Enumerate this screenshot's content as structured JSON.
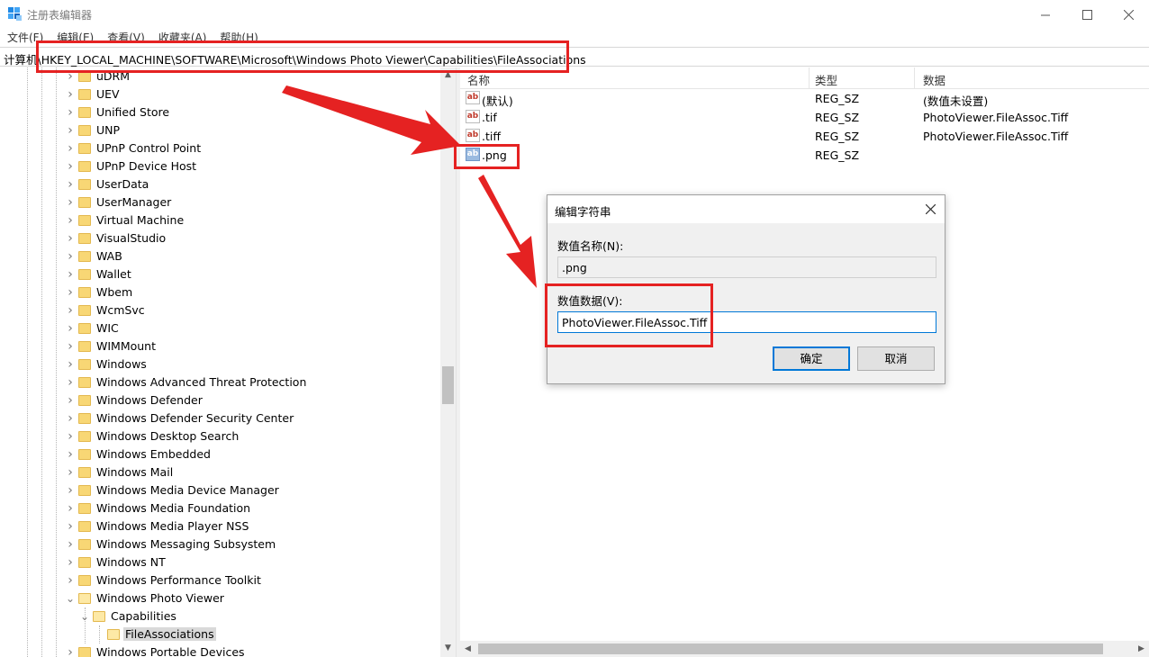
{
  "window": {
    "title": "注册表编辑器",
    "minimize_icon": "minimize-icon",
    "maximize_icon": "maximize-icon",
    "close_icon": "close-icon"
  },
  "menu": [
    "文件(F)",
    "编辑(E)",
    "查看(V)",
    "收藏夹(A)",
    "帮助(H)"
  ],
  "address": "计算机\\HKEY_LOCAL_MACHINE\\SOFTWARE\\Microsoft\\Windows Photo Viewer\\Capabilities\\FileAssociations",
  "tree": {
    "items": [
      {
        "label": "uDRM"
      },
      {
        "label": "UEV"
      },
      {
        "label": "Unified Store"
      },
      {
        "label": "UNP"
      },
      {
        "label": "UPnP Control Point"
      },
      {
        "label": "UPnP Device Host"
      },
      {
        "label": "UserData"
      },
      {
        "label": "UserManager"
      },
      {
        "label": "Virtual Machine"
      },
      {
        "label": "VisualStudio"
      },
      {
        "label": "WAB"
      },
      {
        "label": "Wallet"
      },
      {
        "label": "Wbem"
      },
      {
        "label": "WcmSvc"
      },
      {
        "label": "WIC"
      },
      {
        "label": "WIMMount"
      },
      {
        "label": "Windows"
      },
      {
        "label": "Windows Advanced Threat Protection"
      },
      {
        "label": "Windows Defender"
      },
      {
        "label": "Windows Defender Security Center"
      },
      {
        "label": "Windows Desktop Search"
      },
      {
        "label": "Windows Embedded"
      },
      {
        "label": "Windows Mail"
      },
      {
        "label": "Windows Media Device Manager"
      },
      {
        "label": "Windows Media Foundation"
      },
      {
        "label": "Windows Media Player NSS"
      },
      {
        "label": "Windows Messaging Subsystem"
      },
      {
        "label": "Windows NT"
      },
      {
        "label": "Windows Performance Toolkit"
      },
      {
        "label": "Windows Photo Viewer",
        "expanded": true
      },
      {
        "label": "Capabilities",
        "expanded": true
      },
      {
        "label": "FileAssociations",
        "selected": true
      },
      {
        "label": "Windows Portable Devices"
      }
    ]
  },
  "list": {
    "columns": [
      "名称",
      "类型",
      "数据"
    ],
    "rows": [
      {
        "name": "(默认)",
        "type": "REG_SZ",
        "data": "(数值未设置)"
      },
      {
        "name": ".tif",
        "type": "REG_SZ",
        "data": "PhotoViewer.FileAssoc.Tiff"
      },
      {
        "name": ".tiff",
        "type": "REG_SZ",
        "data": "PhotoViewer.FileAssoc.Tiff"
      },
      {
        "name": ".png",
        "type": "REG_SZ",
        "data": ""
      }
    ],
    "value_icon_text": "ab"
  },
  "dialog": {
    "title": "编辑字符串",
    "name_label": "数值名称(N):",
    "name_value": ".png",
    "data_label": "数值数据(V):",
    "data_value": "PhotoViewer.FileAssoc.Tiff",
    "ok_label": "确定",
    "cancel_label": "取消"
  },
  "colors": {
    "annotation": "#e52222",
    "accent": "#0078d7",
    "folder": "#f8d775"
  }
}
